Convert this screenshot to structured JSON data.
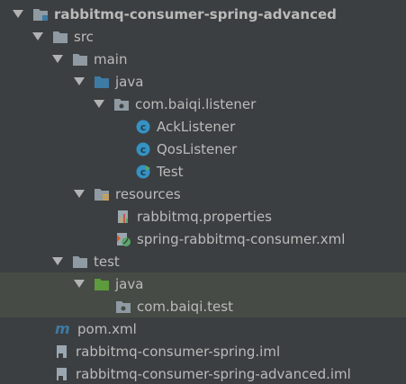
{
  "tree": {
    "root": {
      "label": "rabbitmq-consumer-spring-advanced",
      "icon": "module-folder-icon"
    },
    "src": {
      "label": "src",
      "icon": "folder-icon"
    },
    "main": {
      "label": "main",
      "icon": "folder-icon"
    },
    "main_java": {
      "label": "java",
      "icon": "source-root-folder-icon"
    },
    "pkg_listener": {
      "label": "com.baiqi.listener",
      "icon": "package-icon"
    },
    "ack": {
      "label": "AckListener",
      "icon": "class-icon"
    },
    "qos": {
      "label": "QosListener",
      "icon": "class-icon"
    },
    "test_class": {
      "label": "Test",
      "icon": "class-main-icon"
    },
    "resources": {
      "label": "resources",
      "icon": "resources-folder-icon"
    },
    "props": {
      "label": "rabbitmq.properties",
      "icon": "properties-file-icon"
    },
    "xml": {
      "label": "spring-rabbitmq-consumer.xml",
      "icon": "spring-xml-icon"
    },
    "test": {
      "label": "test",
      "icon": "folder-icon"
    },
    "test_java": {
      "label": "java",
      "icon": "test-source-root-icon"
    },
    "pkg_test": {
      "label": "com.baiqi.test",
      "icon": "package-icon"
    },
    "pom": {
      "label": "pom.xml",
      "icon": "maven-icon"
    },
    "iml1": {
      "label": "rabbitmq-consumer-spring.iml",
      "icon": "iml-file-icon"
    },
    "iml2": {
      "label": "rabbitmq-consumer-spring-advanced.iml",
      "icon": "iml-file-icon"
    }
  },
  "colors": {
    "background": "#3c3f41",
    "highlight": "#464c45",
    "text": "#bbbbbb",
    "folder": "#8f9aa2",
    "source_root": "#3d7aa4",
    "test_root": "#5d9b3d",
    "class_circle": "#3592c4"
  }
}
